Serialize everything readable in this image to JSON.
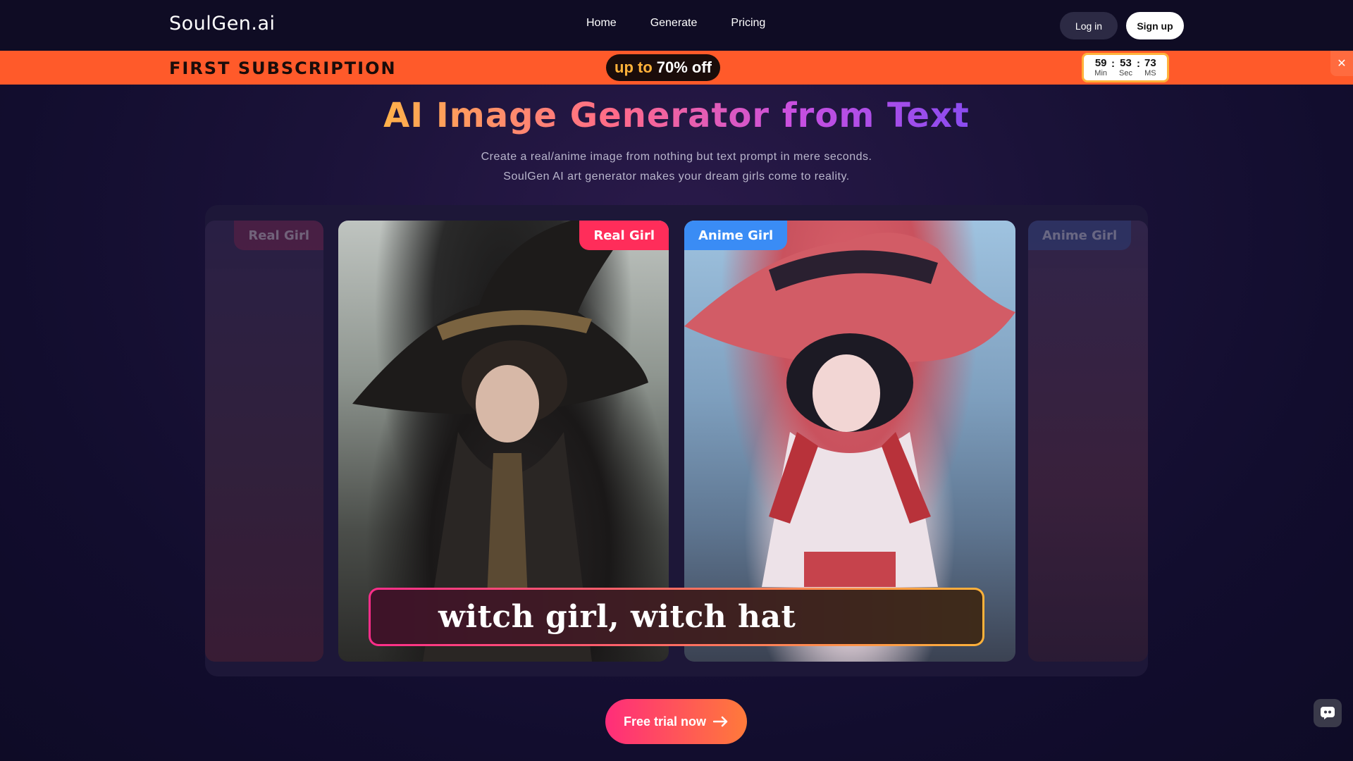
{
  "header": {
    "logo": "SoulGen.ai",
    "nav": [
      "Home",
      "Generate",
      "Pricing"
    ],
    "login_label": "Log in",
    "signup_label": "Sign up"
  },
  "promo": {
    "title": "FIRST SUBSCRIPTION",
    "pill_a": "up to",
    "pill_b": "70% off",
    "timer": {
      "min": "59",
      "sec": "53",
      "ms": "73",
      "min_label": "Min",
      "sec_label": "Sec",
      "ms_label": "MS",
      "sep": ":"
    },
    "close_icon": "close-icon"
  },
  "hero": {
    "title": "AI Image Generator from Text",
    "sub_line1": "Create a real/anime image from nothing but text prompt in mere seconds.",
    "sub_line2": "SoulGen AI art generator makes your dream girls come to reality."
  },
  "carousel": {
    "tags": {
      "left": "Real Girl",
      "real": "Real Girl",
      "anime": "Anime Girl",
      "right": "Anime Girl"
    },
    "prompt": "witch girl, witch hat"
  },
  "cta": {
    "label": "Free trial now",
    "icon": "arrow-right-icon"
  },
  "chat": {
    "icon": "chat-bot-icon"
  },
  "colors": {
    "promo_bg": "#ff5a2a",
    "tag_real": "#ff2d5a",
    "tag_anime": "#3a8cf5",
    "cta_start": "#ff2d7a",
    "cta_end": "#ff7a3a"
  }
}
